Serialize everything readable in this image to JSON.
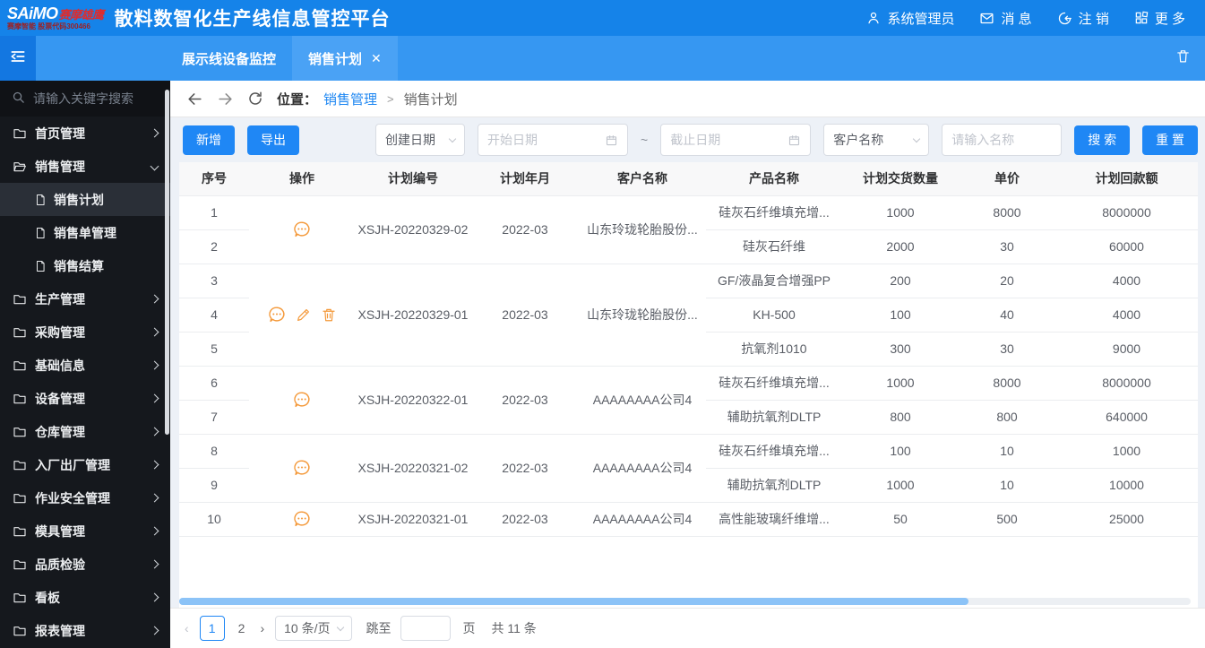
{
  "colors": {
    "accent": "#1f87f5",
    "header_blue": "#1583e9",
    "tabbar_blue": "#3697f2",
    "active_tab_blue": "#4aa2f5",
    "sidebar_dark": "#15181d",
    "action_orange": "#f4993a"
  },
  "header": {
    "logo_line1": "SAiMO",
    "logo_line1_red": "赛摩雄鹰",
    "logo_line2": "赛摩智能 股票代码300466",
    "title": "散料数智化生产线信息管控平台",
    "right": [
      {
        "icon": "user-icon",
        "label": "系统管理员"
      },
      {
        "icon": "mail-icon",
        "label": "消 息"
      },
      {
        "icon": "logout-icon",
        "label": "注 销"
      },
      {
        "icon": "grid-icon",
        "label": "更 多"
      }
    ]
  },
  "tabbar": {
    "fold_icon": "menu-fold-icon",
    "tabs": [
      {
        "label": "展示线设备监控",
        "active": false,
        "closable": false
      },
      {
        "label": "销售计划",
        "active": true,
        "closable": true,
        "close_glyph": "✕"
      }
    ],
    "trash_icon": "trash-icon"
  },
  "sidebar": {
    "search_placeholder": "请输入关键字搜索",
    "items": [
      {
        "label": "首页管理",
        "icon": "folder-icon",
        "expand": "right"
      },
      {
        "label": "销售管理",
        "icon": "folder-open-icon",
        "expand": "down",
        "children": [
          {
            "label": "销售计划",
            "icon": "doc-icon",
            "active": true
          },
          {
            "label": "销售单管理",
            "icon": "doc-icon",
            "active": false
          },
          {
            "label": "销售结算",
            "icon": "doc-icon",
            "active": false
          }
        ]
      },
      {
        "label": "生产管理",
        "icon": "folder-icon",
        "expand": "right"
      },
      {
        "label": "采购管理",
        "icon": "folder-icon",
        "expand": "right"
      },
      {
        "label": "基础信息",
        "icon": "folder-icon",
        "expand": "right"
      },
      {
        "label": "设备管理",
        "icon": "folder-icon",
        "expand": "right"
      },
      {
        "label": "仓库管理",
        "icon": "folder-icon",
        "expand": "right"
      },
      {
        "label": "入厂出厂管理",
        "icon": "folder-icon",
        "expand": "right"
      },
      {
        "label": "作业安全管理",
        "icon": "folder-icon",
        "expand": "right"
      },
      {
        "label": "模具管理",
        "icon": "folder-icon",
        "expand": "right"
      },
      {
        "label": "品质检验",
        "icon": "folder-icon",
        "expand": "right"
      },
      {
        "label": "看板",
        "icon": "folder-icon",
        "expand": "right"
      },
      {
        "label": "报表管理",
        "icon": "folder-icon",
        "expand": "right"
      }
    ]
  },
  "breadcrumb": {
    "prefix": "位置：",
    "parent": "销售管理",
    "separator": ">",
    "current": "销售计划"
  },
  "toolbar": {
    "add_label": "新增",
    "export_label": "导出",
    "date_type_value": "创建日期",
    "start_placeholder": "开始日期",
    "tilde": "~",
    "end_placeholder": "截止日期",
    "filter_field_value": "客户名称",
    "name_placeholder": "请输入名称",
    "search_label": "搜 索",
    "reset_label": "重 置"
  },
  "table": {
    "columns": [
      "序号",
      "操作",
      "计划编号",
      "计划年月",
      "客户名称",
      "产品名称",
      "计划交货数量",
      "单价",
      "计划回款额"
    ],
    "groups": [
      {
        "plan_no": "XSJH-20220329-02",
        "plan_month": "2022-03",
        "customer": "山东玲珑轮胎股份...",
        "actions": [
          "comment-icon"
        ],
        "rows": [
          {
            "no": "1",
            "product": "硅灰石纤维填充增...",
            "qty": "1000",
            "price": "8000",
            "amount": "8000000"
          },
          {
            "no": "2",
            "product": "硅灰石纤维",
            "qty": "2000",
            "price": "30",
            "amount": "60000"
          }
        ]
      },
      {
        "plan_no": "XSJH-20220329-01",
        "plan_month": "2022-03",
        "customer": "山东玲珑轮胎股份...",
        "actions": [
          "comment-icon",
          "edit-icon",
          "delete-icon"
        ],
        "rows": [
          {
            "no": "3",
            "product": "GF/液晶复合增强PP",
            "qty": "200",
            "price": "20",
            "amount": "4000"
          },
          {
            "no": "4",
            "product": "KH-500",
            "qty": "100",
            "price": "40",
            "amount": "4000"
          },
          {
            "no": "5",
            "product": "抗氧剂1010",
            "qty": "300",
            "price": "30",
            "amount": "9000"
          }
        ]
      },
      {
        "plan_no": "XSJH-20220322-01",
        "plan_month": "2022-03",
        "customer": "AAAAAAAA公司4",
        "actions": [
          "comment-icon"
        ],
        "rows": [
          {
            "no": "6",
            "product": "硅灰石纤维填充增...",
            "qty": "1000",
            "price": "8000",
            "amount": "8000000"
          },
          {
            "no": "7",
            "product": "辅助抗氧剂DLTP",
            "qty": "800",
            "price": "800",
            "amount": "640000"
          }
        ]
      },
      {
        "plan_no": "XSJH-20220321-02",
        "plan_month": "2022-03",
        "customer": "AAAAAAAA公司4",
        "actions": [
          "comment-icon"
        ],
        "rows": [
          {
            "no": "8",
            "product": "硅灰石纤维填充增...",
            "qty": "100",
            "price": "10",
            "amount": "1000"
          },
          {
            "no": "9",
            "product": "辅助抗氧剂DLTP",
            "qty": "1000",
            "price": "10",
            "amount": "10000"
          }
        ]
      },
      {
        "plan_no": "XSJH-20220321-01",
        "plan_month": "2022-03",
        "customer": "AAAAAAAA公司4",
        "actions": [
          "comment-icon"
        ],
        "rows": [
          {
            "no": "10",
            "product": "高性能玻璃纤维增...",
            "qty": "50",
            "price": "500",
            "amount": "25000"
          }
        ]
      }
    ]
  },
  "pagination": {
    "prev_glyph": "‹",
    "next_glyph": "›",
    "pages": [
      "1",
      "2"
    ],
    "active_page": "1",
    "page_size_value": "10 条/页",
    "jump_label": "跳至",
    "page_unit_label": "页",
    "total_label": "共 11 条"
  }
}
